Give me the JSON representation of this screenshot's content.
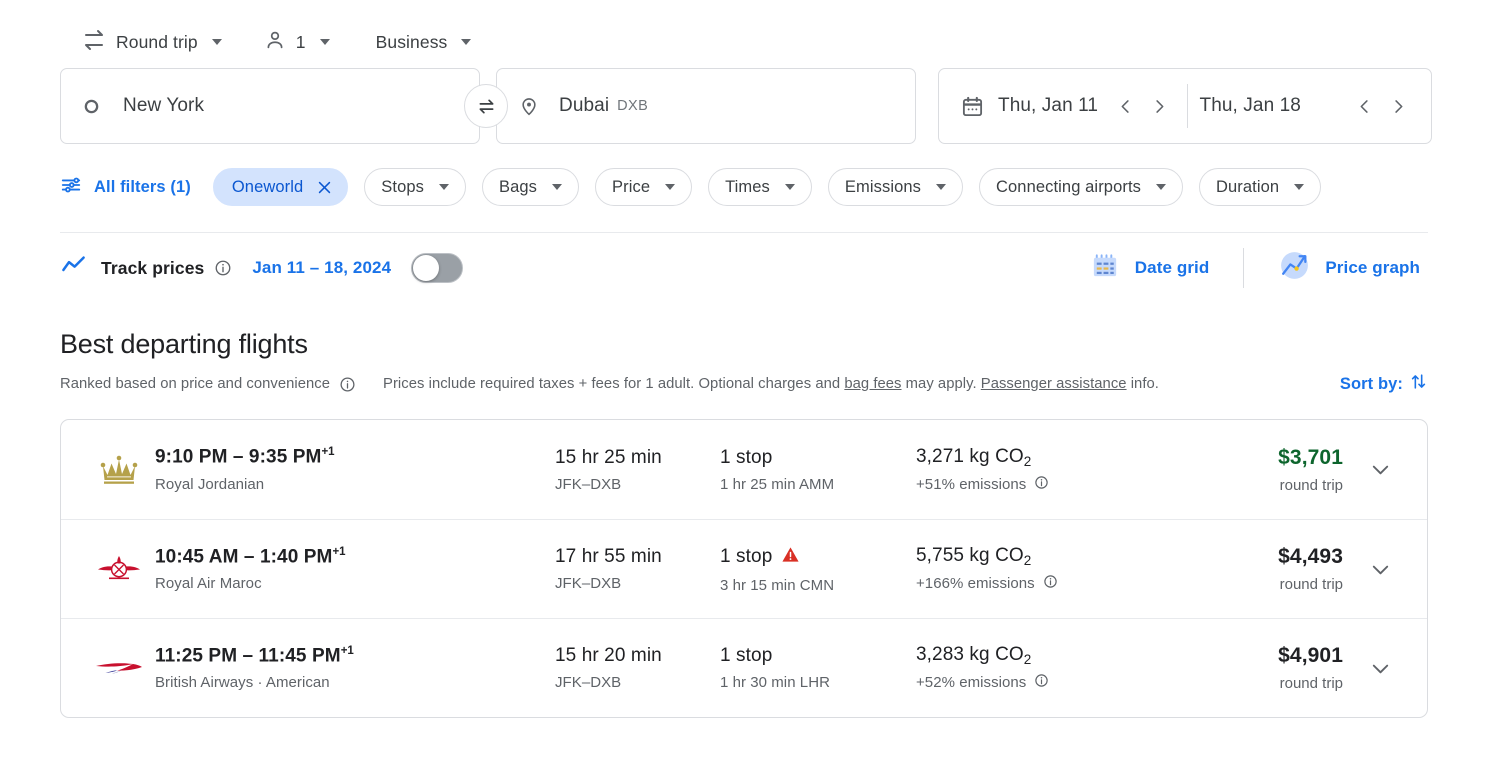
{
  "trip_options": {
    "trip_type": {
      "label": "Round trip",
      "icon": "swap-horiz-icon"
    },
    "passengers": {
      "label": "1",
      "icon": "person-icon"
    },
    "cabin_class": {
      "label": "Business"
    }
  },
  "search": {
    "origin": {
      "value": "New York",
      "icon": "circle-outline-icon"
    },
    "swap": {
      "icon": "swap-arrows-icon"
    },
    "destination": {
      "value": "Dubai",
      "code": "DXB",
      "icon": "location-pin-icon"
    },
    "depart_date": {
      "value": "Thu, Jan 11",
      "icon": "calendar-icon"
    },
    "return_date": {
      "value": "Thu, Jan 18"
    },
    "prev_icon": "chevron-left-icon",
    "next_icon": "chevron-right-icon"
  },
  "filters": {
    "all_filters": {
      "label": "All filters (1)",
      "icon": "tune-icon"
    },
    "chips": [
      {
        "label": "Oneworld",
        "active": true,
        "removable": true
      },
      {
        "label": "Stops",
        "active": false
      },
      {
        "label": "Bags",
        "active": false
      },
      {
        "label": "Price",
        "active": false
      },
      {
        "label": "Times",
        "active": false
      },
      {
        "label": "Emissions",
        "active": false
      },
      {
        "label": "Connecting airports",
        "active": false
      },
      {
        "label": "Duration",
        "active": false
      }
    ]
  },
  "track_prices": {
    "label": "Track prices",
    "info_icon": "info-icon",
    "date_range": "Jan 11 – 18, 2024",
    "toggle_state": "off",
    "trend_icon": "trending-up-icon"
  },
  "view_tools": {
    "date_grid": {
      "label": "Date grid",
      "icon": "date-grid-icon"
    },
    "price_graph": {
      "label": "Price graph",
      "icon": "price-graph-icon"
    }
  },
  "results_header": {
    "title": "Best departing flights",
    "ranked_note": "Ranked based on price and convenience",
    "info_icon": "info-icon",
    "disclaimer_pre": "Prices include required taxes + fees for 1 adult. Optional charges and ",
    "bag_fees_link": "bag fees",
    "disclaimer_mid": " may apply. ",
    "assistance_link": "Passenger assistance",
    "disclaimer_post": " info.",
    "sort_by": {
      "label": "Sort by:",
      "icon": "sort-arrows-icon"
    }
  },
  "flights": [
    {
      "airline_logo": "royal-jordanian-crown-logo",
      "times": "9:10 PM – 9:35 PM",
      "day_offset": "+1",
      "airline": "Royal Jordanian",
      "duration": "15 hr 25 min",
      "route": "JFK–DXB",
      "stops": "1 stop",
      "warning": false,
      "layover": "1 hr 25 min AMM",
      "emissions": "3,271 kg CO",
      "emissions_sub": "2",
      "emissions_delta": "+51% emissions",
      "price": "$3,701",
      "price_color": "green",
      "price_note": "round trip",
      "expand_icon": "chevron-down-icon"
    },
    {
      "airline_logo": "royal-air-maroc-logo",
      "times": "10:45 AM – 1:40 PM",
      "day_offset": "+1",
      "airline": "Royal Air Maroc",
      "duration": "17 hr 55 min",
      "route": "JFK–DXB",
      "stops": "1 stop",
      "warning": true,
      "layover": "3 hr 15 min CMN",
      "emissions": "5,755 kg CO",
      "emissions_sub": "2",
      "emissions_delta": "+166% emissions",
      "price": "$4,493",
      "price_color": "dark",
      "price_note": "round trip",
      "expand_icon": "chevron-down-icon"
    },
    {
      "airline_logo": "british-airways-logo",
      "times": "11:25 PM – 11:45 PM",
      "day_offset": "+1",
      "airline": "British Airways · American",
      "duration": "15 hr 20 min",
      "route": "JFK–DXB",
      "stops": "1 stop",
      "warning": false,
      "layover": "1 hr 30 min LHR",
      "emissions": "3,283 kg CO",
      "emissions_sub": "2",
      "emissions_delta": "+52% emissions",
      "price": "$4,901",
      "price_color": "dark",
      "price_note": "round trip",
      "expand_icon": "chevron-down-icon"
    }
  ],
  "colors": {
    "accent_blue": "#1a73e8",
    "chip_active_bg": "#d3e3fd",
    "chip_active_text": "#0b57d0",
    "price_green": "#0d652d",
    "warning_red": "#d93025"
  }
}
